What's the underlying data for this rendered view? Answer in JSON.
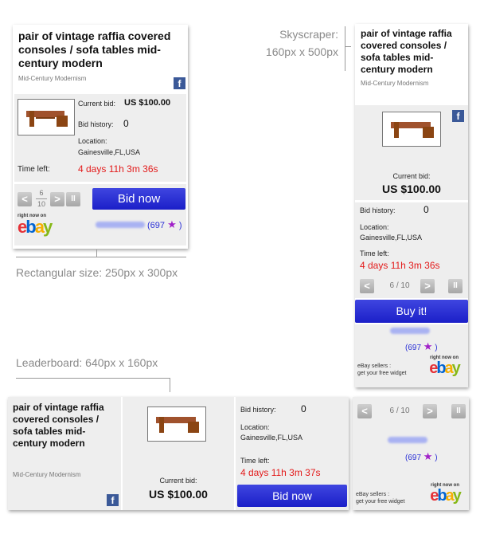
{
  "listing": {
    "title": "pair of vintage raffia covered consoles / sofa tables mid-century modern",
    "category": "Mid-Century Modernism",
    "current_bid_label": "Current bid:",
    "current_bid_colon": "Current bid:",
    "price": "US $100.00",
    "bid_history_label": "Bid history:",
    "bid_count": "0",
    "location_label": "Location:",
    "location": "Gainesville,FL,USA",
    "time_left_label": "Time left:",
    "time_left_a": "4 days 11h 3m 36s",
    "time_left_b": "4 days 11h 3m 37s",
    "feedback": "(697",
    "feedback_close": ")"
  },
  "buttons": {
    "bid_now": "Bid now",
    "buy_it": "Buy it!",
    "prev": "<",
    "next": ">",
    "pause": "II"
  },
  "pager": {
    "current": "6",
    "total": "10",
    "label": "6 / 10"
  },
  "branding": {
    "right_now_on": "right now on",
    "ebay_e": "e",
    "ebay_b": "b",
    "ebay_a": "a",
    "ebay_y": "y",
    "sellers_line1": "eBay sellers :",
    "sellers_line2": "get your free widget",
    "facebook": "f"
  },
  "annotations": {
    "rectangular": "Rectangular size:  250px x 300px",
    "skyscraper_name": "Skyscraper:",
    "skyscraper_size": "160px x 500px",
    "leaderboard": "Leaderboard: 640px x 160px"
  },
  "colors": {
    "bid_button": "#2a30d6",
    "time_red": "#e31a1a",
    "ebay_red": "#e53238",
    "ebay_blue": "#0064d2",
    "ebay_yellow": "#f5af02",
    "ebay_green": "#86b817",
    "facebook_blue": "#3b5998"
  }
}
